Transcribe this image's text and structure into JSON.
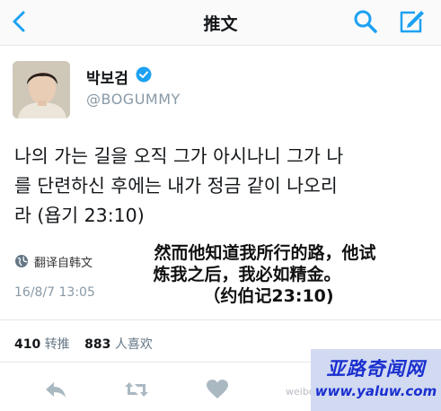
{
  "nav": {
    "title": "推文"
  },
  "user": {
    "name": "박보검",
    "handle": "@BOGUMMY"
  },
  "tweet": {
    "lines": [
      "나의 가는 길을 오직 그가 아시나니 그가 나",
      "를 단련하신 후에는 내가 정금 같이 나오리",
      "라 (욥기 23:10)"
    ],
    "translate_label": "翻译自韩文",
    "timestamp": "16/8/7 13:05"
  },
  "overlay_translation": {
    "lines": [
      "然而他知道我所行的路，他试",
      "炼我之后，我必如精金。",
      "（约伯记23:10)"
    ]
  },
  "stats": {
    "retweets": "410",
    "retweets_label": "转推",
    "likes": "883",
    "likes_label": "人喜欢"
  },
  "watermark": {
    "site_name": "亚路奇闻网",
    "url": "www.yaluw.com",
    "weibo_mark": "weibo"
  },
  "colors": {
    "accent": "#1da1f2",
    "muted": "#8899a6",
    "icon_gray": "#aab8c2",
    "watermark_blue": "#1a2fcf"
  },
  "icons": [
    "back-arrow-icon",
    "search-icon",
    "compose-icon",
    "verified-badge-icon",
    "globe-icon",
    "reply-icon",
    "retweet-icon",
    "like-heart-icon"
  ]
}
